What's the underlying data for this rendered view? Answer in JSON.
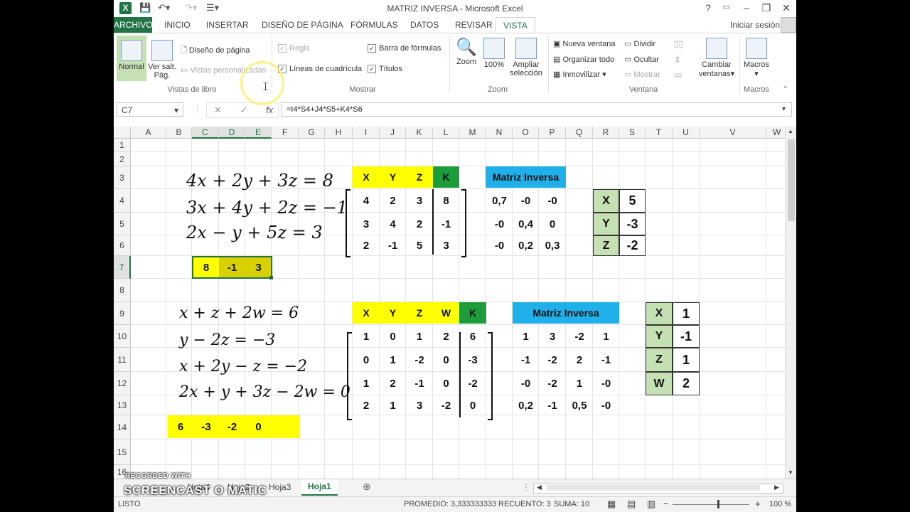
{
  "window": {
    "title": "MATRIZ INVERSA - Microsoft Excel",
    "app_icon": "excel-icon",
    "signin": "Iniciar sesión",
    "controls": [
      "?",
      "▭",
      "–",
      "❐",
      "✕"
    ]
  },
  "tabs": [
    "ARCHIVO",
    "INICIO",
    "INSERTAR",
    "DISEÑO DE PÁGINA",
    "FÓRMULAS",
    "DATOS",
    "REVISAR",
    "VISTA"
  ],
  "active_tab": "VISTA",
  "ribbon": {
    "vistas_libro": {
      "label": "Vistas de libro",
      "normal": "Normal",
      "ver_salt": "Ver salt.",
      "ver_salt2": "Pág.",
      "diseno": "Diseño de página",
      "vistas_pers": "Vistas personalizadas"
    },
    "mostrar": {
      "label": "Mostrar",
      "regla": "Regla",
      "barra": "Barra de fórmulas",
      "lineas": "Líneas de cuadrícula",
      "titulos": "Títulos"
    },
    "zoom": {
      "label": "Zoom",
      "zoom": "Zoom",
      "z100": "100%",
      "ampliar": "Ampliar",
      "seleccion": "selección"
    },
    "ventana": {
      "label": "Ventana",
      "nueva": "Nueva ventana",
      "organizar": "Organizar todo",
      "inmovilizar": "Inmovilizar",
      "dividir": "Dividir",
      "ocultar": "Ocultar",
      "mostrar": "Mostrar",
      "cambiar": "Cambiar",
      "ventanas": "ventanas"
    },
    "macros": {
      "label": "Macros",
      "macros": "Macros"
    }
  },
  "formula_bar": {
    "namebox": "C7",
    "fx": "fx",
    "formula": "=I4*S4+J4*S5+K4*S6"
  },
  "columns": [
    "A",
    "B",
    "C",
    "D",
    "E",
    "F",
    "G",
    "H",
    "I",
    "J",
    "K",
    "L",
    "M",
    "N",
    "O",
    "P",
    "Q",
    "R",
    "S",
    "T",
    "U",
    "V",
    "W"
  ],
  "rows": [
    "1",
    "2",
    "3",
    "4",
    "5",
    "6",
    "7",
    "8",
    "9",
    "10",
    "11",
    "12",
    "13",
    "14",
    "15",
    "16"
  ],
  "system1": {
    "equations": [
      "4x + 2y + 3z = 8",
      "3x + 4y + 2z = −1",
      "2x − y + 5z = 3"
    ],
    "check": [
      "8",
      "-1",
      "3"
    ],
    "headers": [
      "X",
      "Y",
      "Z",
      "K"
    ],
    "matrix": [
      [
        "4",
        "2",
        "3",
        "8"
      ],
      [
        "3",
        "4",
        "2",
        "-1"
      ],
      [
        "2",
        "-1",
        "5",
        "3"
      ]
    ],
    "inverse_title": "Matriz Inversa",
    "inverse": [
      [
        "0,7",
        "-0",
        "-0"
      ],
      [
        "-0",
        "0,4",
        "0"
      ],
      [
        "-0",
        "0,2",
        "0,3"
      ]
    ],
    "results": [
      [
        "X",
        "5"
      ],
      [
        "Y",
        "-3"
      ],
      [
        "Z",
        "-2"
      ]
    ]
  },
  "system2": {
    "equations": [
      "x + z + 2w = 6",
      "y − 2z = −3",
      "x + 2y − z = −2",
      "2x + y + 3z − 2w = 0"
    ],
    "check": [
      "6",
      "-3",
      "-2",
      "0"
    ],
    "headers": [
      "X",
      "Y",
      "Z",
      "W",
      "K"
    ],
    "matrix": [
      [
        "1",
        "0",
        "1",
        "2",
        "6"
      ],
      [
        "0",
        "1",
        "-2",
        "0",
        "-3"
      ],
      [
        "1",
        "2",
        "-1",
        "0",
        "-2"
      ],
      [
        "2",
        "1",
        "3",
        "-2",
        "0"
      ]
    ],
    "inverse_title": "Matriz Inversa",
    "inverse": [
      [
        "1",
        "3",
        "-2",
        "1"
      ],
      [
        "-1",
        "-2",
        "2",
        "-1"
      ],
      [
        "-0",
        "-2",
        "1",
        "-0"
      ],
      [
        "0,2",
        "-1",
        "0,5",
        "-0"
      ]
    ],
    "results": [
      [
        "X",
        "1"
      ],
      [
        "Y",
        "-1"
      ],
      [
        "Z",
        "1"
      ],
      [
        "W",
        "2"
      ]
    ]
  },
  "sheets": [
    "Hoja4",
    "Hoja2",
    "Hoja3",
    "Hoja1"
  ],
  "active_sheet": "Hoja1",
  "status": {
    "mode": "LISTO",
    "promedio": "PROMEDIO: 3,333333333",
    "recuento": "RECUENTO: 3",
    "suma": "SUMA: 10",
    "zoom": "100 %"
  },
  "watermark": {
    "line1": "RECORDED WITH",
    "line2": "SCREENCAST O MATIC"
  }
}
